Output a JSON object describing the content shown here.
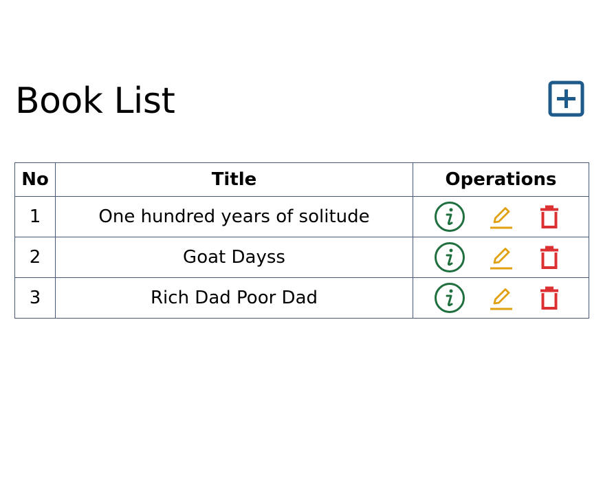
{
  "page": {
    "title": "Book List"
  },
  "header": {
    "add_icon": "plus-square-icon",
    "add_color": "#1f5b8a"
  },
  "table": {
    "columns": [
      "No",
      "Title",
      "Operations"
    ],
    "rows": [
      {
        "no": "1",
        "title": "One hundred years of solitude"
      },
      {
        "no": "2",
        "title": "Goat Dayss"
      },
      {
        "no": "3",
        "title": "Rich Dad Poor Dad"
      }
    ],
    "operations": {
      "info_icon": "info-circle-icon",
      "edit_icon": "pencil-icon",
      "delete_icon": "trash-icon"
    }
  },
  "colors": {
    "info": "#1f6f3f",
    "edit": "#e0a010",
    "delete": "#dc3033",
    "border": "#465775"
  }
}
